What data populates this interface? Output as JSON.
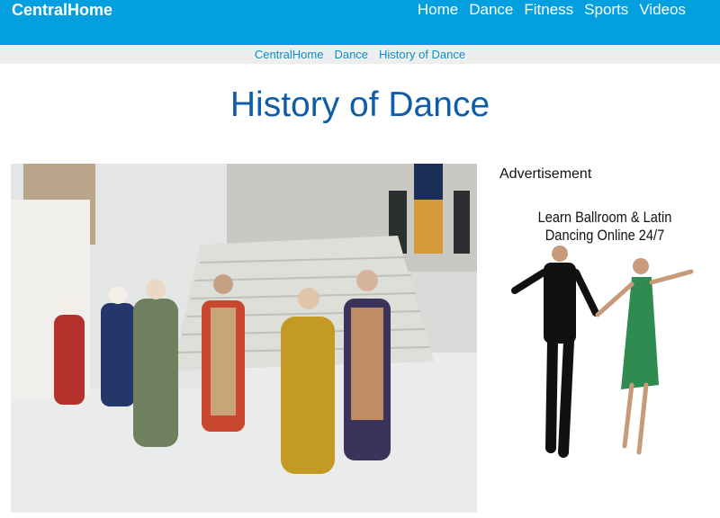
{
  "header": {
    "brand": "CentralHome",
    "nav": [
      "Home",
      "Dance",
      "Fitness",
      "Sports",
      "Videos"
    ]
  },
  "breadcrumb": [
    "CentralHome",
    "Dance",
    "History of Dance"
  ],
  "page_title": "History of Dance",
  "photo": {
    "description": "medieval-dancers-photo"
  },
  "ad": {
    "label": "Advertisement",
    "line1": "Learn Ballroom & Latin",
    "line2": "Dancing Online 24/7"
  },
  "colors": {
    "header_bg": "#049fde",
    "breadcrumb_bg": "#eeeeee",
    "link": "#0b8fc9",
    "title": "#0f5ca8"
  }
}
